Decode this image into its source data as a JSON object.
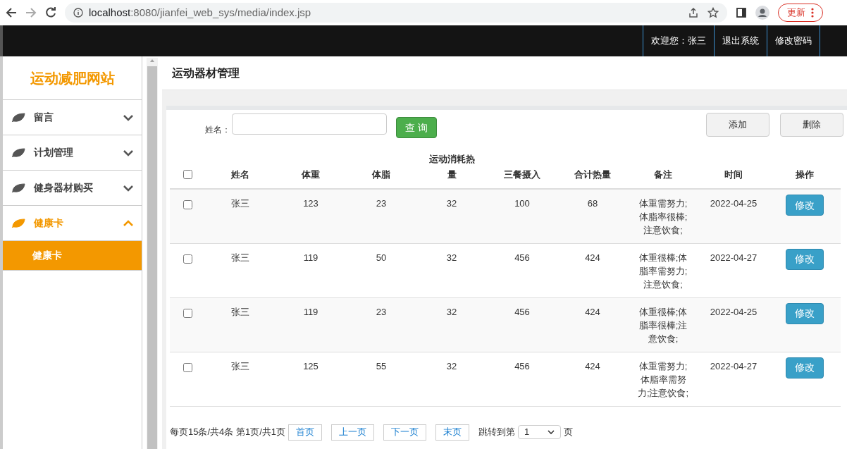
{
  "browser": {
    "url_host": "localhost",
    "url_rest": ":8080/jianfei_web_sys/media/index.jsp",
    "update_button": "更新"
  },
  "header": {
    "links": [
      "欢迎您：张三",
      "退出系统",
      "修改密码"
    ]
  },
  "sidebar": {
    "title": "运动减肥网站",
    "items": [
      {
        "label": "留言",
        "expanded": false
      },
      {
        "label": "计划管理",
        "expanded": false
      },
      {
        "label": "健身器材购买",
        "expanded": false
      },
      {
        "label": "健康卡",
        "expanded": true,
        "children": [
          {
            "label": "健康卡",
            "selected": true
          }
        ]
      }
    ]
  },
  "page_title": "运动器材管理",
  "search": {
    "label": "姓名：",
    "button": "查 询"
  },
  "actions": [
    "添加",
    "删除"
  ],
  "table": {
    "select_all_checked": false,
    "columns": [
      "姓名",
      "体重",
      "体脂",
      "运动消耗热量",
      "三餐摄入",
      "合计热量",
      "备注",
      "时间",
      "操作"
    ],
    "rows": [
      {
        "checked": false,
        "cells": [
          "张三",
          "123",
          "23",
          "32",
          "100",
          "68",
          "体重需努力;体脂率很棒;注意饮食;",
          "2022-04-25"
        ],
        "action": "修改"
      },
      {
        "checked": false,
        "cells": [
          "张三",
          "119",
          "50",
          "32",
          "456",
          "424",
          "体重很棒;体脂率需努力;注意饮食;",
          "2022-04-27"
        ],
        "action": "修改"
      },
      {
        "checked": false,
        "cells": [
          "张三",
          "119",
          "23",
          "32",
          "456",
          "424",
          "体重很棒;体脂率很棒;注意饮食;",
          "2022-04-25"
        ],
        "action": "修改"
      },
      {
        "checked": false,
        "cells": [
          "张三",
          "125",
          "55",
          "32",
          "456",
          "424",
          "体重需努力;体脂率需努力;注意饮食;",
          "2022-04-27"
        ],
        "action": "修改"
      }
    ]
  },
  "pagination": {
    "summary": "每页15条/共4条 第1页/共1页",
    "buttons": [
      "首页",
      "上一页",
      "下一页",
      "末页"
    ],
    "jump_label": "跳转到第",
    "jump_value": "1",
    "jump_suffix": "页"
  }
}
